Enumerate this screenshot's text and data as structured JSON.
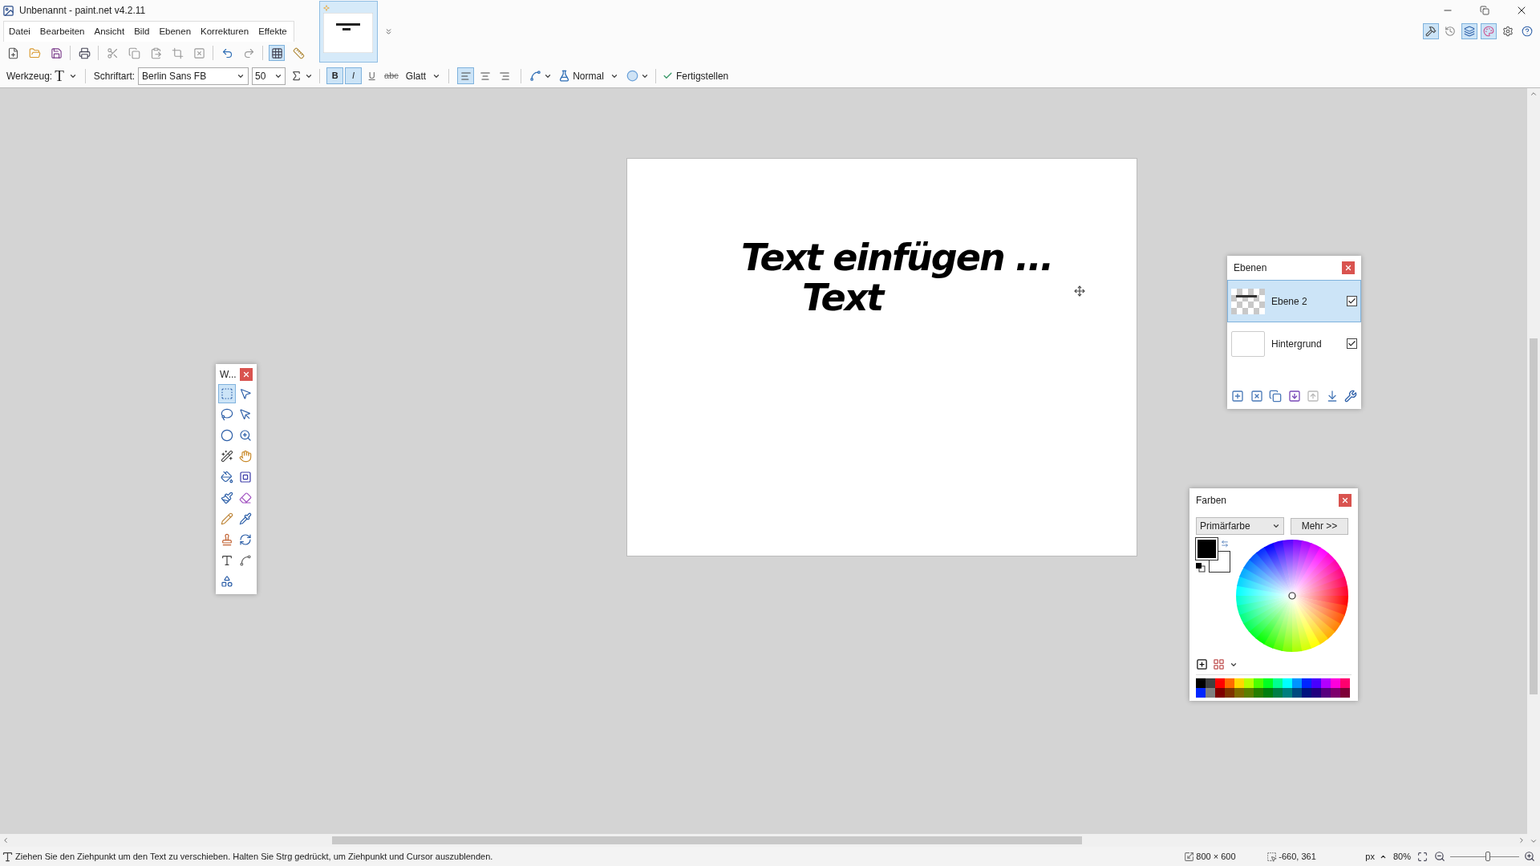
{
  "window": {
    "title": "Unbenannt - paint.net v4.2.11"
  },
  "menu": [
    "Datei",
    "Bearbeiten",
    "Ansicht",
    "Bild",
    "Ebenen",
    "Korrekturen",
    "Effekte"
  ],
  "image_tabs": [
    {
      "selected": true
    }
  ],
  "panel_toggles": [
    {
      "kind": "tools",
      "selected": true
    },
    {
      "kind": "history",
      "selected": false
    },
    {
      "kind": "layers",
      "selected": true
    },
    {
      "kind": "colors",
      "selected": true
    },
    {
      "kind": "settings",
      "selected": false
    },
    {
      "kind": "help",
      "selected": false
    }
  ],
  "toolbar": [
    {
      "kind": "new"
    },
    {
      "kind": "open"
    },
    {
      "kind": "save"
    },
    {
      "kind": "sep"
    },
    {
      "kind": "print"
    },
    {
      "kind": "sep"
    },
    {
      "kind": "cut"
    },
    {
      "kind": "copy"
    },
    {
      "kind": "paste"
    },
    {
      "kind": "crop"
    },
    {
      "kind": "deselect"
    },
    {
      "kind": "sep"
    },
    {
      "kind": "undo"
    },
    {
      "kind": "redo"
    },
    {
      "kind": "sep"
    },
    {
      "kind": "grid",
      "selected": true
    },
    {
      "kind": "ruler",
      "selected": false
    }
  ],
  "tool_options": {
    "tool_label": "Werkzeug:",
    "tool_glyph": "T",
    "font_label": "Schriftart:",
    "font": "Berlin Sans FB",
    "size": "50",
    "styles": [
      {
        "label": "B",
        "selected": true,
        "kind": "bold"
      },
      {
        "label": "I",
        "selected": true,
        "kind": "italic"
      },
      {
        "label": "U",
        "selected": false,
        "kind": "underline"
      },
      {
        "label": "abc",
        "selected": false,
        "kind": "strike"
      }
    ],
    "rendering": "Glatt",
    "align": [
      {
        "kind": "left",
        "selected": true
      },
      {
        "kind": "center",
        "selected": false
      },
      {
        "kind": "right",
        "selected": false
      }
    ],
    "blend": "Normal",
    "finish": "Fertigstellen"
  },
  "canvas": {
    "lines": [
      "Text einfügen ...",
      "Text"
    ]
  },
  "tools_window": {
    "title": "W...",
    "tools": [
      {
        "kind": "rect-select",
        "selected": true
      },
      {
        "kind": "move-selected",
        "selected": false
      },
      {
        "kind": "lasso",
        "selected": false
      },
      {
        "kind": "move-selection",
        "selected": false
      },
      {
        "kind": "ellipse-select",
        "selected": false
      },
      {
        "kind": "zoom",
        "selected": false
      },
      {
        "kind": "magic-wand",
        "selected": false
      },
      {
        "kind": "pan",
        "selected": false
      },
      {
        "kind": "bucket",
        "selected": false
      },
      {
        "kind": "gradient",
        "selected": false
      },
      {
        "kind": "brush",
        "selected": false
      },
      {
        "kind": "eraser",
        "selected": false
      },
      {
        "kind": "pencil",
        "selected": false
      },
      {
        "kind": "picker",
        "selected": false
      },
      {
        "kind": "stamp",
        "selected": false
      },
      {
        "kind": "recolor",
        "selected": false
      },
      {
        "kind": "text",
        "selected": false
      },
      {
        "kind": "line",
        "selected": false
      },
      {
        "kind": "shapes",
        "selected": false
      }
    ]
  },
  "layers_window": {
    "title": "Ebenen",
    "layers": [
      {
        "name": "Ebene 2",
        "selected": true,
        "visible": true,
        "kind": "transparent"
      },
      {
        "name": "Hintergrund",
        "selected": false,
        "visible": true,
        "kind": "white"
      }
    ]
  },
  "colors_window": {
    "title": "Farben",
    "mode": "Primärfarbe",
    "more": "Mehr >>",
    "swatches": [
      {
        "color": "#000000"
      },
      {
        "color": "#ffffff"
      }
    ],
    "palette": [
      {
        "color": "#000000"
      },
      {
        "color": "#404040"
      },
      {
        "color": "#ff0000"
      },
      {
        "color": "#ff6a00"
      },
      {
        "color": "#ffd800"
      },
      {
        "color": "#b6ff00"
      },
      {
        "color": "#4cff00"
      },
      {
        "color": "#00ff21"
      },
      {
        "color": "#00ff90"
      },
      {
        "color": "#00ffff"
      },
      {
        "color": "#0094ff"
      },
      {
        "color": "#0026ff"
      },
      {
        "color": "#4800ff"
      },
      {
        "color": "#b200ff"
      },
      {
        "color": "#ff00dc"
      },
      {
        "color": "#ff006e"
      },
      {
        "color": "#0026ff"
      },
      {
        "color": "#808080"
      },
      {
        "color": "#7f0000"
      },
      {
        "color": "#7f3300"
      },
      {
        "color": "#7f6a00"
      },
      {
        "color": "#5b7f00"
      },
      {
        "color": "#267f00"
      },
      {
        "color": "#007f0e"
      },
      {
        "color": "#007f46"
      },
      {
        "color": "#007f7f"
      },
      {
        "color": "#004a7f"
      },
      {
        "color": "#00137f"
      },
      {
        "color": "#21007f"
      },
      {
        "color": "#57007f"
      },
      {
        "color": "#7f006e"
      },
      {
        "color": "#7f0037"
      }
    ]
  },
  "status_bar": {
    "hint": "Ziehen Sie den Ziehpunkt um den Text zu verschieben. Halten Sie Strg gedrückt, um Ziehpunkt und Cursor auszublenden.",
    "size": "800 × 600",
    "position": "-660, 361",
    "unit": "px",
    "zoom": "80%",
    "zoom_level": {
      "level": 0.55
    }
  }
}
